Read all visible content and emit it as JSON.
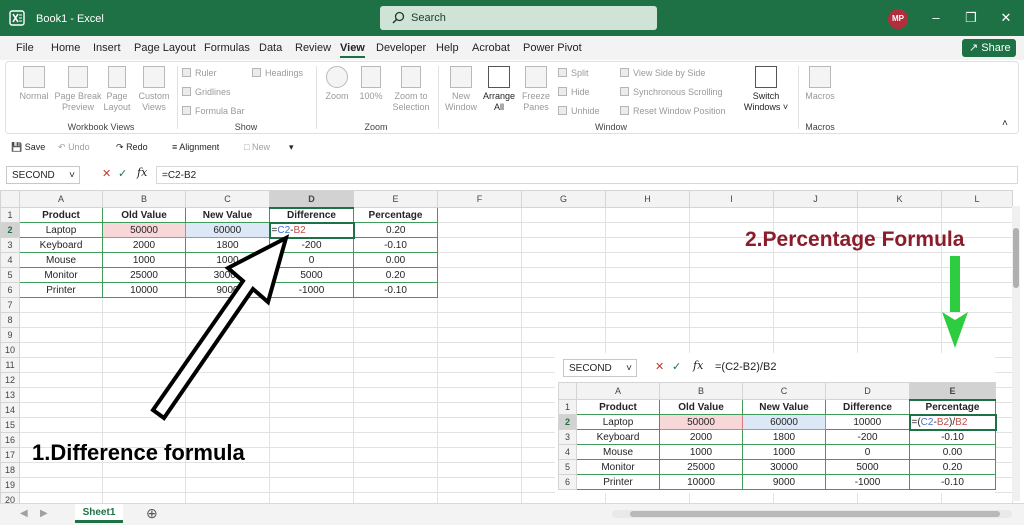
{
  "titlebar": {
    "title": "Book1  -  Excel",
    "search_placeholder": "Search",
    "avatar_initials": "MP",
    "accent": "#1e7145"
  },
  "menu": {
    "items": [
      "File",
      "Home",
      "Insert",
      "Page Layout",
      "Formulas",
      "Data",
      "Review",
      "View",
      "Developer",
      "Help",
      "Acrobat",
      "Power Pivot"
    ],
    "active": "View",
    "share_label": "Share"
  },
  "ribbon": {
    "workbook_views": {
      "normal": "Normal",
      "page_break": "Page Break Preview",
      "page_layout": "Page Layout",
      "custom_views": "Custom Views",
      "group": "Workbook Views"
    },
    "show": {
      "ruler": "Ruler",
      "headings": "Headings",
      "gridlines": "Gridlines",
      "formula_bar": "Formula Bar",
      "group": "Show"
    },
    "zoom": {
      "zoom": "Zoom",
      "hundred": "100%",
      "zoom_selection": "Zoom to Selection",
      "group": "Zoom"
    },
    "window": {
      "new_window": "New Window",
      "arrange_all": "Arrange All",
      "freeze": "Freeze Panes",
      "split": "Split",
      "hide": "Hide",
      "unhide": "Unhide",
      "side_by_side": "View Side by Side",
      "sync_scroll": "Synchronous Scrolling",
      "reset_pos": "Reset Window Position",
      "switch": "Switch Windows",
      "group": "Window"
    },
    "macros": {
      "macros": "Macros",
      "group": "Macros"
    }
  },
  "qat": {
    "save": "Save",
    "undo": "Undo",
    "redo": "Redo",
    "alignment": "Alignment",
    "new": "New"
  },
  "formula_bar": {
    "name_box": "SECOND",
    "formula": "=C2-B2"
  },
  "columns": [
    "A",
    "B",
    "C",
    "D",
    "E",
    "F",
    "G",
    "H",
    "I",
    "J",
    "K",
    "L"
  ],
  "rows": [
    "1",
    "2",
    "3",
    "4",
    "5",
    "6",
    "7",
    "8",
    "9",
    "10",
    "11",
    "12",
    "13",
    "14",
    "15",
    "16",
    "17",
    "18",
    "19",
    "20"
  ],
  "table": {
    "headers": [
      "Product",
      "Old Value",
      "New Value",
      "Difference",
      "Percentage"
    ],
    "rows": [
      [
        "Laptop",
        "50000",
        "60000",
        "",
        "0.20"
      ],
      [
        "Keyboard",
        "2000",
        "1800",
        "-200",
        "-0.10"
      ],
      [
        "Mouse",
        "1000",
        "1000",
        "0",
        "0.00"
      ],
      [
        "Monitor",
        "25000",
        "30000",
        "5000",
        "0.20"
      ],
      [
        "Printer",
        "10000",
        "9000",
        "-1000",
        "-0.10"
      ]
    ],
    "active_formula_eq": "=",
    "active_formula_c2": "C2",
    "active_formula_op": "-",
    "active_formula_b2": "B2"
  },
  "inset": {
    "name_box": "SECOND",
    "formula": "=(C2-B2)/B2",
    "columns": [
      "A",
      "B",
      "C",
      "D",
      "E"
    ],
    "rows": [
      "1",
      "2",
      "3",
      "4",
      "5",
      "6"
    ],
    "headers": [
      "Product",
      "Old Value",
      "New Value",
      "Difference",
      "Percentage"
    ],
    "data": [
      [
        "Laptop",
        "50000",
        "60000",
        "10000",
        ""
      ],
      [
        "Keyboard",
        "2000",
        "1800",
        "-200",
        "-0.10"
      ],
      [
        "Mouse",
        "1000",
        "1000",
        "0",
        "0.00"
      ],
      [
        "Monitor",
        "25000",
        "30000",
        "5000",
        "0.20"
      ],
      [
        "Printer",
        "10000",
        "9000",
        "-1000",
        "-0.10"
      ]
    ],
    "formula_parts": [
      "=(",
      "C2",
      "-",
      "B2",
      ")/",
      "B2"
    ]
  },
  "annotations": {
    "difference": "1.Difference formula",
    "percentage": "2.Percentage Formula",
    "arrow_green": "#2ecc40",
    "arrow_black": "#000000"
  },
  "sheet_tab": "Sheet1"
}
